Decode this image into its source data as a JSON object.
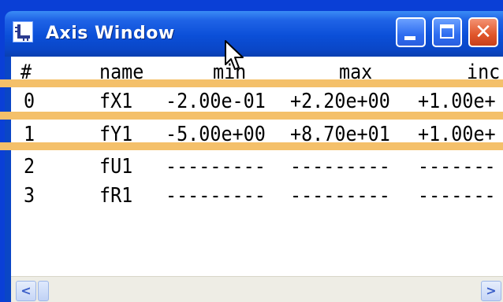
{
  "window": {
    "title": "Axis Window",
    "icon": "axis-chart-icon",
    "controls": {
      "minimize": "minimize-icon",
      "maximize": "maximize-icon",
      "close_glyph": "✕"
    }
  },
  "table": {
    "columns": [
      "#",
      "name",
      "min",
      "max",
      "inc"
    ],
    "rows": [
      {
        "index": "0",
        "name": "fX1",
        "min": "-2.00e-01",
        "max": "+2.20e+00",
        "inc": "+1.00e+"
      },
      {
        "index": "1",
        "name": "fY1",
        "min": "-5.00e+00",
        "max": "+8.70e+01",
        "inc": "+1.00e+"
      },
      {
        "index": "2",
        "name": "fU1",
        "min": "---------",
        "max": "---------",
        "inc": "-------"
      },
      {
        "index": "3",
        "name": "fR1",
        "min": "---------",
        "max": "---------",
        "inc": "-------"
      }
    ]
  },
  "scrollbar": {
    "left_glyph": "<",
    "right_glyph": ">"
  },
  "colors": {
    "desktop": "#0a3fd6",
    "titlebar": "#0b4fd8",
    "highlight_line": "#f4c06a",
    "close_button": "#e0552a"
  }
}
